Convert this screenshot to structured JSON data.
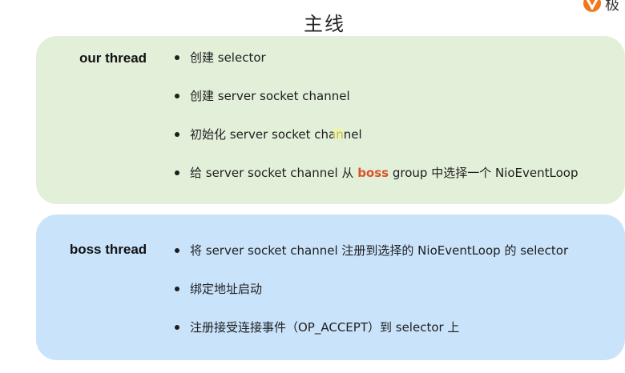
{
  "title": "主线",
  "logo_text": "极",
  "colors": {
    "green_panel": "#e2efd9",
    "blue_panel": "#c9e3fb",
    "highlight": "#d9532a",
    "logo": "#f0781e"
  },
  "panels": [
    {
      "label": "our thread",
      "items": [
        {
          "text": "创建 selector"
        },
        {
          "text": "创建 server socket channel"
        },
        {
          "text": "初始化 server socket channel"
        },
        {
          "pre": "给 server socket channel 从 ",
          "highlight": "boss",
          "post": " group 中选择一个 NioEventLoop"
        }
      ]
    },
    {
      "label": "boss thread",
      "items": [
        {
          "text": "将 server socket channel 注册到选择的 NioEventLoop 的 selector"
        },
        {
          "text": "绑定地址启动"
        },
        {
          "text": "注册接受连接事件（OP_ACCEPT）到 selector 上"
        }
      ]
    }
  ]
}
